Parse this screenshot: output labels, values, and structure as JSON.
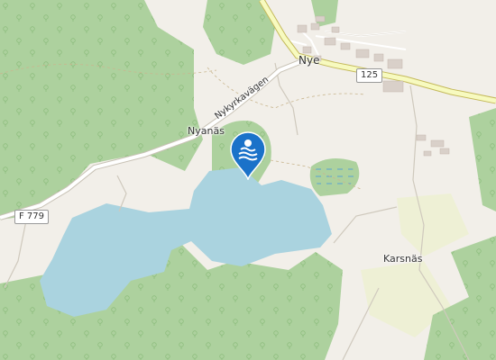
{
  "map": {
    "labels": {
      "town": "Nye",
      "village_1": "Nyanäs",
      "village_2": "Karsnäs",
      "street": "Nykyrkavägen"
    },
    "road_shields": {
      "road_125": "125",
      "road_f779": "F 779"
    },
    "marker": {
      "icon": "swimming-icon",
      "color": "#1a72c9"
    },
    "colors": {
      "land": "#f2efe9",
      "forest": "#add19e",
      "water": "#aad3df",
      "main_road": "#f7fabf"
    }
  }
}
